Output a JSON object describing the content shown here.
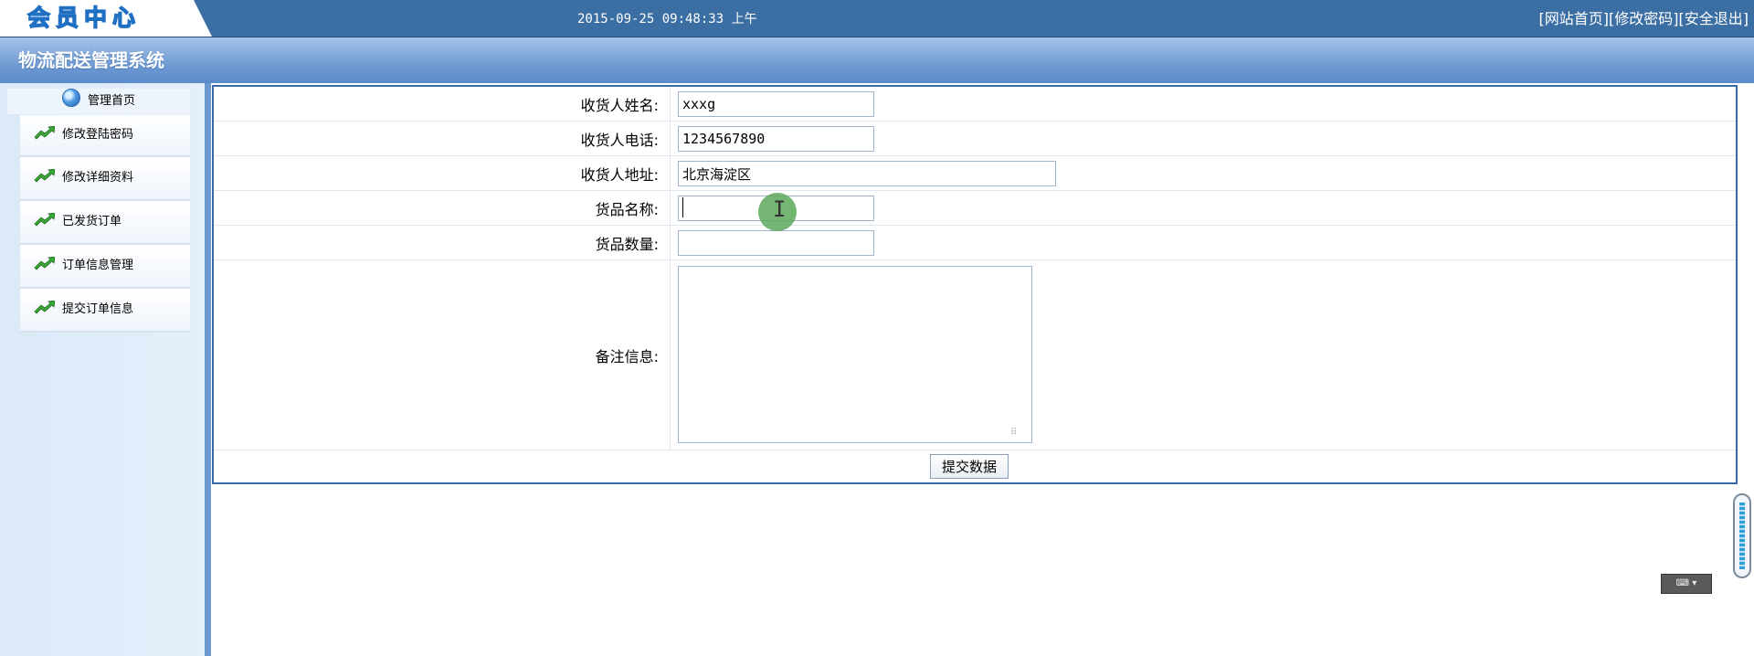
{
  "header": {
    "logo_text": "会员中心",
    "datetime": "2015-09-25 09:48:33 上午",
    "links": [
      "[网站首页]",
      "[修改密码]",
      "[安全退出]"
    ]
  },
  "subheader": {
    "system_title": "物流配送管理系统"
  },
  "sidebar": {
    "header_label": "管理首页",
    "items": [
      {
        "label": "修改登陆密码"
      },
      {
        "label": "修改详细资料"
      },
      {
        "label": "已发货订单"
      },
      {
        "label": "订单信息管理"
      },
      {
        "label": "提交订单信息"
      }
    ]
  },
  "form": {
    "rows": [
      {
        "label": "收货人姓名:",
        "value": "xxxg"
      },
      {
        "label": "收货人电话:",
        "value": "1234567890"
      },
      {
        "label": "收货人地址:",
        "value": "北京海淀区"
      },
      {
        "label": "货品名称:",
        "value": ""
      },
      {
        "label": "货品数量:",
        "value": ""
      }
    ],
    "notes_label": "备注信息:",
    "notes_value": "",
    "submit_label": "提交数据"
  },
  "colors": {
    "topbar": "#3b6fa3",
    "subbar": "#6f9ad2",
    "panel_border": "#3a6aa5",
    "click_indicator": "#5ca85c"
  }
}
